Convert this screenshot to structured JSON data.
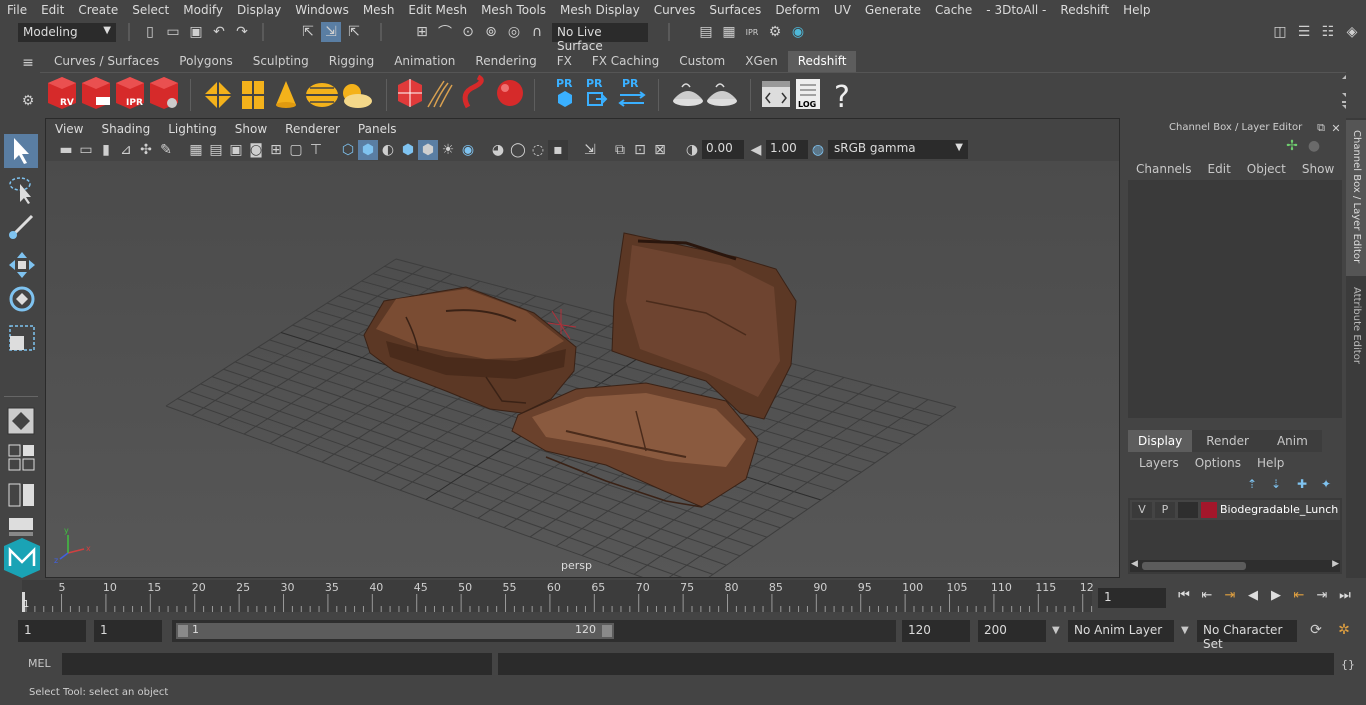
{
  "menubar": {
    "items": [
      "File",
      "Edit",
      "Create",
      "Select",
      "Modify",
      "Display",
      "Windows",
      "Mesh",
      "Edit Mesh",
      "Mesh Tools",
      "Mesh Display",
      "Curves",
      "Surfaces",
      "Deform",
      "UV",
      "Generate",
      "Cache",
      "- 3DtoAll -",
      "Redshift",
      "Help"
    ]
  },
  "statusline": {
    "workspace": "Modeling",
    "live_surface": "No Live Surface"
  },
  "shelf": {
    "tabs": [
      "Curves / Surfaces",
      "Polygons",
      "Sculpting",
      "Rigging",
      "Animation",
      "Rendering",
      "FX",
      "FX Caching",
      "Custom",
      "XGen",
      "Redshift"
    ],
    "active_tab": "Redshift",
    "icons": {
      "rv": "RV",
      "ipr": "IPR",
      "pr1": "PR",
      "pr2": "PR",
      "pr3": "PR",
      "log": "LOG",
      "help": "?"
    }
  },
  "viewport": {
    "menus": [
      "View",
      "Shading",
      "Lighting",
      "Show",
      "Renderer",
      "Panels"
    ],
    "exposure": "0.00",
    "gamma": "1.00",
    "color_space": "sRGB gamma",
    "camera_label": "persp"
  },
  "channelbox": {
    "title": "Channel Box / Layer Editor",
    "menus": [
      "Channels",
      "Edit",
      "Object",
      "Show"
    ],
    "tabs": [
      "Display",
      "Render",
      "Anim"
    ],
    "active_tab": "Display",
    "layer_menus": [
      "Layers",
      "Options",
      "Help"
    ],
    "layer": {
      "v": "V",
      "p": "P",
      "name": "Biodegradable_Lunch_",
      "color": "#a3172b"
    }
  },
  "sidetabs": {
    "tab1": "Channel Box / Layer Editor",
    "tab2": "Attribute Editor"
  },
  "timeline": {
    "ticks": [
      "5",
      "10",
      "15",
      "20",
      "25",
      "30",
      "35",
      "40",
      "45",
      "50",
      "55",
      "60",
      "65",
      "70",
      "75",
      "80",
      "85",
      "90",
      "95",
      "100",
      "105",
      "110",
      "115",
      "12"
    ],
    "start_marker": "1",
    "current_frame": "1"
  },
  "range": {
    "start": "1",
    "playback_start": "1",
    "slider_start": "1",
    "slider_end": "120",
    "playback_end": "120",
    "end": "200",
    "anim_layer": "No Anim Layer",
    "character_set": "No Character Set"
  },
  "cmdline": {
    "label": "MEL"
  },
  "helpline": {
    "text": "Select Tool: select an object"
  }
}
